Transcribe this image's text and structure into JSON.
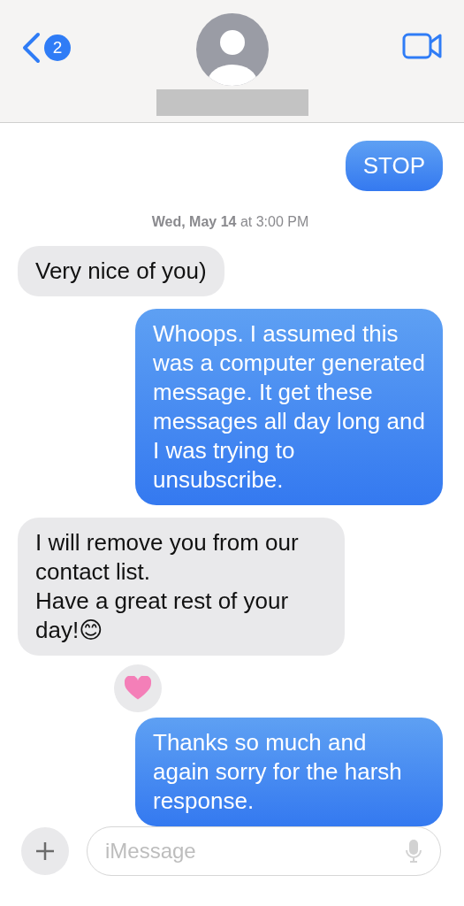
{
  "header": {
    "back_badge": "2"
  },
  "messages": [
    {
      "kind": "sent",
      "text": "STOP",
      "reacted": false
    },
    {
      "kind": "timestamp",
      "text": "**Wed, May 14** at 3:00 PM"
    },
    {
      "kind": "received",
      "text": "Very nice of you)",
      "reacted": false
    },
    {
      "kind": "sent",
      "text": "Whoops. I assumed this was a computer generated message. It get these messages all day long and I was trying to unsubscribe.",
      "reacted": false
    },
    {
      "kind": "received",
      "text": "I will remove you from our contact list.\nHave a great rest of your day!😊",
      "reacted": false
    },
    {
      "kind": "sent",
      "text": "Thanks so much and again sorry for the harsh response.",
      "reacted": true
    }
  ],
  "composer": {
    "placeholder": "iMessage"
  }
}
